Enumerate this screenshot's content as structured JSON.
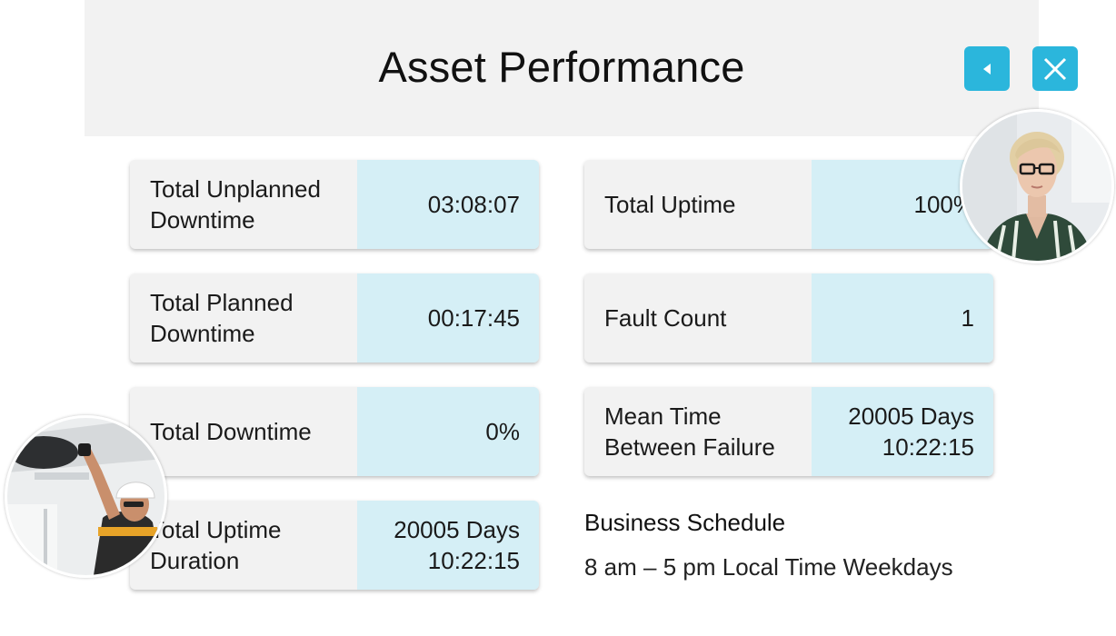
{
  "header": {
    "title": "Asset Performance",
    "back_icon": "back-arrow-icon",
    "close_icon": "close-icon",
    "accent_color": "#2bb6dc"
  },
  "metrics_left": [
    {
      "label": "Total Unplanned Downtime",
      "value": "03:08:07"
    },
    {
      "label": "Total Planned Downtime",
      "value": "00:17:45"
    },
    {
      "label": "Total Downtime",
      "value": "0%"
    },
    {
      "label": "Total Uptime Duration",
      "value": "20005 Days 10:22:15"
    }
  ],
  "metrics_right": [
    {
      "label": "Total Uptime",
      "value": "100%"
    },
    {
      "label": "Fault Count",
      "value": "1"
    },
    {
      "label": "Mean Time Between Failure",
      "value": "20005 Days 10:22:15"
    }
  ],
  "schedule": {
    "title": "Business Schedule",
    "text": "8 am – 5 pm Local Time Weekdays"
  },
  "colors": {
    "value_bg": "#d5eff6",
    "label_bg": "#f2f2f2"
  }
}
